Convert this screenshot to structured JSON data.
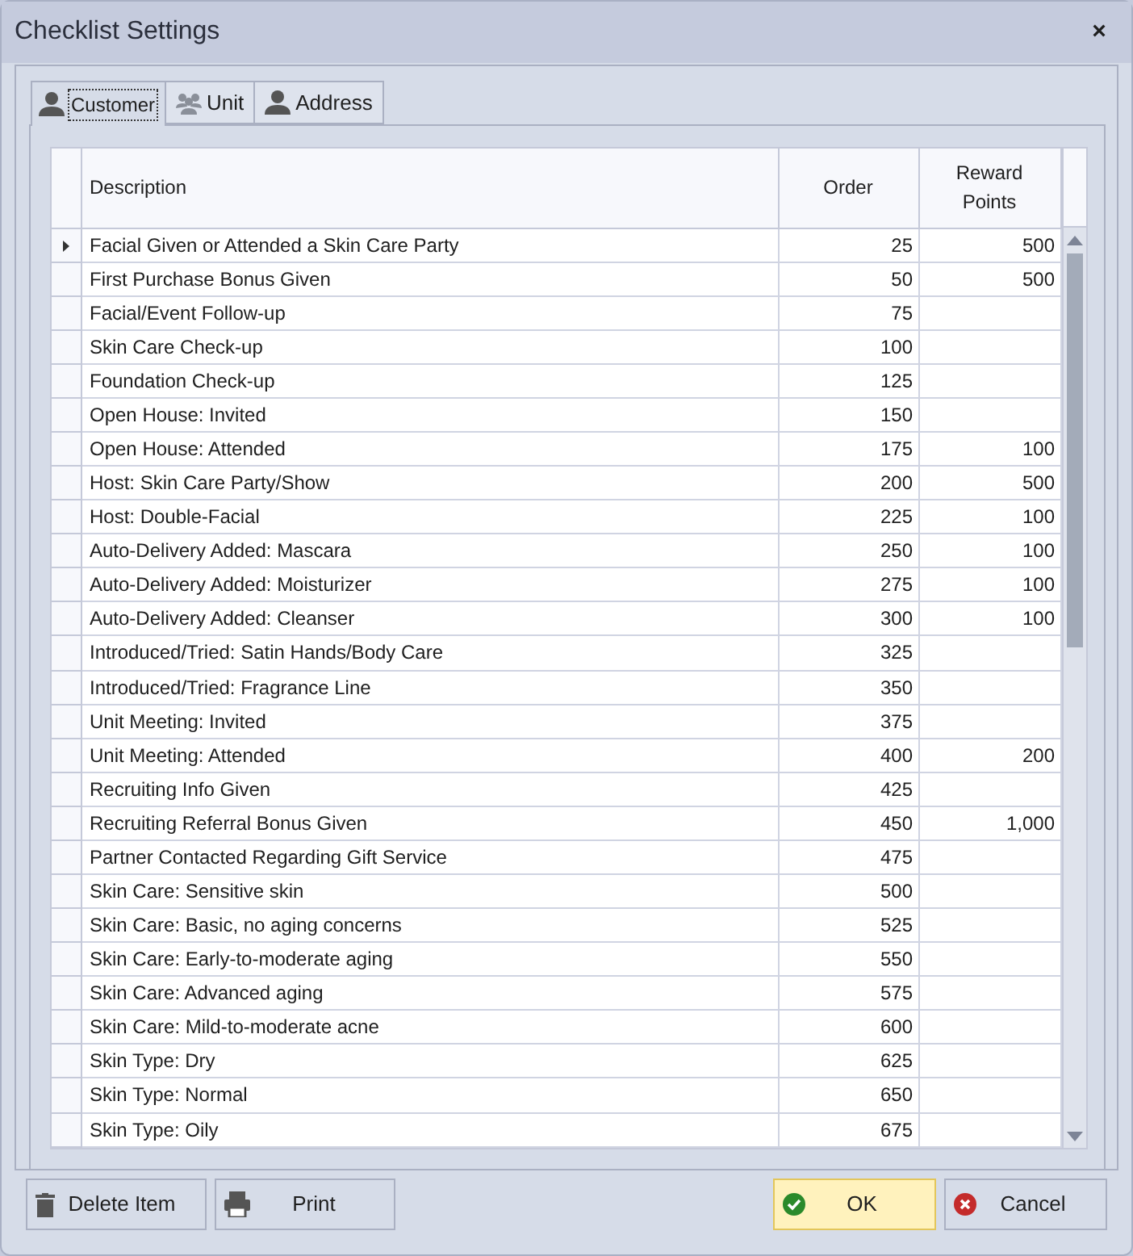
{
  "window": {
    "title": "Checklist Settings",
    "close": "×"
  },
  "tabs": [
    {
      "label": "Customer",
      "kind": "person",
      "selected": true
    },
    {
      "label": "Unit",
      "kind": "group",
      "selected": false
    },
    {
      "label": "Address",
      "kind": "person",
      "selected": false
    }
  ],
  "table": {
    "columns": [
      "Description",
      "Order",
      "Reward Points"
    ],
    "rows": [
      {
        "description": "Facial Given or Attended a Skin Care Party",
        "order": "25",
        "reward_points": "500",
        "focused": true
      },
      {
        "description": "First Purchase Bonus Given",
        "order": "50",
        "reward_points": "500",
        "focused": false
      },
      {
        "description": "Facial/Event Follow-up",
        "order": "75",
        "focused": false
      },
      {
        "description": "Skin Care Check-up",
        "order": "100",
        "focused": false
      },
      {
        "description": "Foundation Check-up",
        "order": "125",
        "focused": false
      },
      {
        "description": "Open House: Invited",
        "order": "150",
        "focused": false
      },
      {
        "description": "Open House: Attended",
        "order": "175",
        "reward_points": "100",
        "focused": false
      },
      {
        "description": "Host: Skin Care Party/Show",
        "order": "200",
        "reward_points": "500",
        "focused": false
      },
      {
        "description": "Host: Double-Facial",
        "order": "225",
        "reward_points": "100",
        "focused": false
      },
      {
        "description": "Auto-Delivery Added: Mascara",
        "order": "250",
        "reward_points": "100",
        "focused": false
      },
      {
        "description": "Auto-Delivery Added: Moisturizer",
        "order": "275",
        "reward_points": "100",
        "focused": false
      },
      {
        "description": "Auto-Delivery Added: Cleanser",
        "order": "300",
        "reward_points": "100",
        "focused": false
      },
      {
        "description": "Introduced/Tried: Satin Hands/Body Care",
        "order": "325",
        "focused": false
      },
      {
        "description": "Introduced/Tried: Fragrance Line",
        "order": "350",
        "focused": false
      },
      {
        "description": "Unit Meeting: Invited",
        "order": "375",
        "focused": false
      },
      {
        "description": "Unit Meeting: Attended",
        "order": "400",
        "reward_points": "200",
        "focused": false
      },
      {
        "description": "Recruiting Info Given",
        "order": "425",
        "focused": false
      },
      {
        "description": "Recruiting Referral Bonus Given",
        "order": "450",
        "reward_points": "1,000",
        "focused": false
      },
      {
        "description": "Partner Contacted Regarding Gift Service",
        "order": "475",
        "focused": false
      },
      {
        "description": "Skin Care: Sensitive skin",
        "order": "500",
        "focused": false
      },
      {
        "description": "Skin Care: Basic, no aging concerns",
        "order": "525",
        "focused": false
      },
      {
        "description": "Skin Care: Early-to-moderate aging",
        "order": "550",
        "focused": false
      },
      {
        "description": "Skin Care: Advanced aging",
        "order": "575",
        "focused": false
      },
      {
        "description": "Skin Care: Mild-to-moderate acne",
        "order": "600",
        "focused": false
      },
      {
        "description": "Skin Type: Dry",
        "order": "625",
        "focused": false
      },
      {
        "description": "Skin Type: Normal",
        "order": "650",
        "focused": false
      },
      {
        "description": "Skin Type: Oily",
        "order": "675",
        "focused": false
      }
    ]
  },
  "buttons": [
    {
      "label": "Delete Item",
      "kind": "trash",
      "default": false
    },
    {
      "label": "Print",
      "kind": "printer",
      "default": false
    },
    {
      "label": "OK",
      "kind": "check",
      "default": true
    },
    {
      "label": "Cancel",
      "kind": "cross",
      "default": false
    }
  ]
}
